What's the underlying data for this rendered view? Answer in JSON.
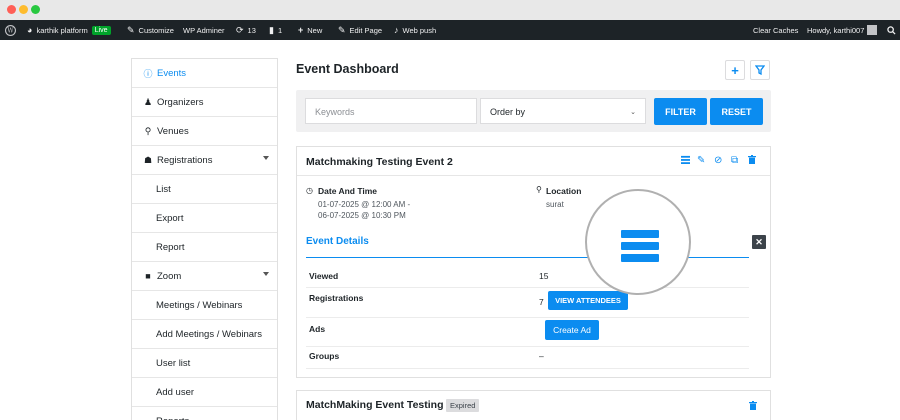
{
  "window": {
    "dots": [
      "#ff5f57",
      "#febc2e",
      "#28c840"
    ]
  },
  "adminbar": {
    "site_name": "karthik platform",
    "live_badge": "Live",
    "customize": "Customize",
    "wp_adminer": "WP Adminer",
    "updates_count": "13",
    "comments_count": "1",
    "new_label": "New",
    "edit_page": "Edit Page",
    "web_push": "Web push",
    "clear_caches": "Clear Caches",
    "howdy": "Howdy, karthi007"
  },
  "sidebar": {
    "items": [
      {
        "label": "Events",
        "icon": "info-icon",
        "glyph": "ⓘ",
        "active": true
      },
      {
        "label": "Organizers",
        "icon": "organizer-icon",
        "glyph": "♟"
      },
      {
        "label": "Venues",
        "icon": "location-pin-icon",
        "glyph": "⚲"
      },
      {
        "label": "Registrations",
        "icon": "users-icon",
        "glyph": "☗",
        "caret": true
      },
      {
        "label": "List",
        "sub": true
      },
      {
        "label": "Export",
        "sub": true
      },
      {
        "label": "Report",
        "sub": true
      },
      {
        "label": "Zoom",
        "icon": "video-icon",
        "glyph": "■",
        "caret": true
      },
      {
        "label": "Meetings / Webinars",
        "sub": true
      },
      {
        "label": "Add Meetings / Webinars",
        "sub": true
      },
      {
        "label": "User list",
        "sub": true
      },
      {
        "label": "Add user",
        "sub": true
      },
      {
        "label": "Reports",
        "sub": true
      }
    ]
  },
  "header": {
    "title": "Event Dashboard",
    "add_glyph": "+",
    "filter_glyph": "⛛"
  },
  "filters": {
    "keywords_placeholder": "Keywords",
    "order_by": "Order by",
    "filter_button": "FILTER",
    "reset_button": "RESET"
  },
  "event": {
    "title": "Matchmaking Testing Event 2",
    "date_label": "Date And Time",
    "date_start": "01-07-2025 @ 12:00 AM -",
    "date_end": "06-07-2025 @ 10:30 PM",
    "location_label": "Location",
    "location_value": "surat",
    "details_title": "Event Details",
    "rows": {
      "viewed_label": "Viewed",
      "viewed_value": "15",
      "registrations_label": "Registrations",
      "registrations_value": "7",
      "view_attendees": "VIEW ATTENDEES",
      "ads_label": "Ads",
      "create_ad": "Create Ad",
      "groups_label": "Groups",
      "groups_value": "–"
    }
  },
  "event2": {
    "title": "MatchMaking Event Testing",
    "badge": "Expired"
  },
  "colors": {
    "accent": "#0b8cf0",
    "adminbar": "#1d2327",
    "live": "#00a32a"
  }
}
